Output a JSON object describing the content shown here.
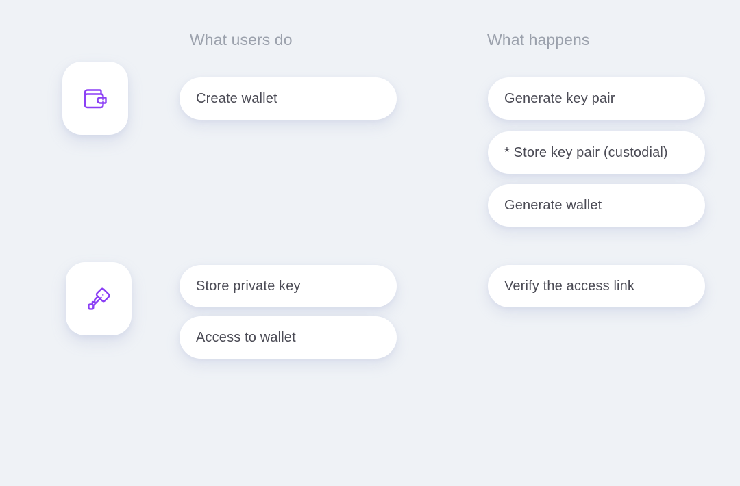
{
  "theme": {
    "background": "#eff2f6",
    "card_background": "#ffffff",
    "accent_purple": "#8b3ff5",
    "header_text": "#9ba1ac",
    "pill_text": "#4b4b55"
  },
  "columns": {
    "users": {
      "header": "What users do",
      "items": [
        {
          "label": "Create wallet",
          "icon": "wallet-icon"
        },
        {
          "label": "Store private key",
          "icon": "key-icon"
        },
        {
          "label": "Access to wallet",
          "icon": "key-icon"
        }
      ]
    },
    "happens": {
      "header": "What happens",
      "items": [
        {
          "label": "Generate key pair"
        },
        {
          "label": "* Store key pair (custodial)"
        },
        {
          "label": "Generate wallet"
        },
        {
          "label": "Verify the access link"
        }
      ]
    }
  },
  "icons": [
    {
      "name": "wallet-icon",
      "semantic": "wallet"
    },
    {
      "name": "key-icon",
      "semantic": "key"
    }
  ]
}
